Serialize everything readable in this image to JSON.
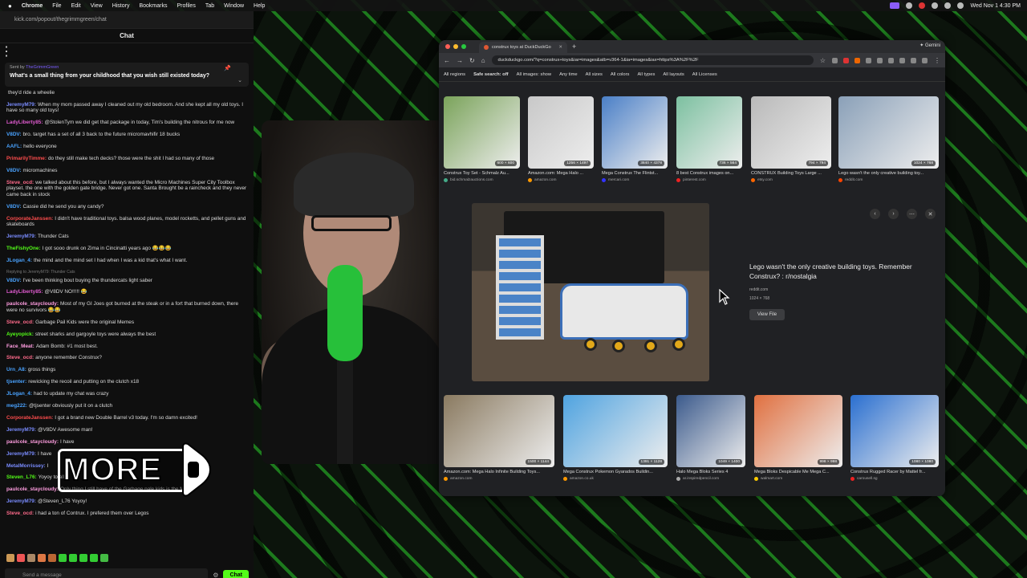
{
  "menubar": {
    "app": "Chrome",
    "items": [
      "File",
      "Edit",
      "View",
      "History",
      "Bookmarks",
      "Profiles",
      "Tab",
      "Window",
      "Help"
    ],
    "clock": "Wed Nov 1 4:30 PM"
  },
  "chat": {
    "url": "kick.com/popout/thegrimmgreen/chat",
    "title": "Chat",
    "pinned": {
      "sent_by_prefix": "Sent by",
      "sent_by_user": "TheGrimmGreen",
      "question": "What's a small thing from your childhood that you wish still existed today?"
    },
    "messages": [
      {
        "user": "",
        "color": "#ddd",
        "text": "they'd ride a wheelie"
      },
      {
        "user": "JeremyM79:",
        "color": "#7a8cff",
        "text": "When my mom passed away I cleaned out my old bedroom. And she kept all my old toys. I have so many old toys!"
      },
      {
        "user": "LadyLiberty85:",
        "color": "#e05bd0",
        "text": "@StolenTym we did get that package in today, Tim's building the nitrous for me now"
      },
      {
        "user": "V8DV:",
        "color": "#4aa3ff",
        "text": "bro. target has a set of all 3 back to the future micromavhifir 18 bucks"
      },
      {
        "user": "AAFL:",
        "color": "#4aa3ff",
        "text": "hello everyone"
      },
      {
        "user": "PrimarilyTimme:",
        "color": "#ff4d4d",
        "text": "do they still make tech decks? those were the shit I had so many of those"
      },
      {
        "user": "V8DV:",
        "color": "#4aa3ff",
        "text": "micromachines"
      },
      {
        "user": "Steve_ocd:",
        "color": "#ff6b8b",
        "text": "we talked about this before, but I always wanted the Micro Machines Super City Toolbox playset. the one with the golden gate bridge. Never got one. Santa Brought be a raincheck and they never came back in stock"
      },
      {
        "user": "V8DV:",
        "color": "#4aa3ff",
        "text": "Cassie did he send you any candy?"
      },
      {
        "user": "CorporateJanssen:",
        "color": "#ff4d4d",
        "text": "I didn't have traditional toys. balsa wood planes, model rocketts, and pellet guns and skateboards"
      },
      {
        "user": "JeremyM79:",
        "color": "#7a8cff",
        "text": "Thunder Cats"
      },
      {
        "user": "TheFishyOne:",
        "color": "#53fc18",
        "text": "I got sooo drunk on Zima in Cincinatti years ago 😂😂😂"
      },
      {
        "user": "JLogan_4:",
        "color": "#4aa3ff",
        "text": "the mind and the mind set I had when I was a kid that's what I want."
      },
      {
        "user": "V8DV:",
        "color": "#4aa3ff",
        "text": "I've been thinking bout buying the thundercats light saber",
        "reply": "Replying to JeremyM79: Thunder Cats"
      },
      {
        "user": "LadyLiberty85:",
        "color": "#e05bd0",
        "text": "@V8DV NO!!!!! 😂"
      },
      {
        "user": "paulcole_staycloudy:",
        "color": "#ff9de0",
        "text": "Most of my GI Joes got burned at the steak or in a fort that burned down, there were no survivors 😂😂"
      },
      {
        "user": "Steve_ocd:",
        "color": "#ff6b8b",
        "text": "Garbage Pail Kids were the original Memes"
      },
      {
        "user": "Ayeyopick:",
        "color": "#53fc18",
        "text": "street sharks and gargoyle toys were always the best"
      },
      {
        "user": "Face_Meat:",
        "color": "#ff9de0",
        "text": "Adam Bomb: #1 most best."
      },
      {
        "user": "Steve_ocd:",
        "color": "#ff6b8b",
        "text": "anyone remember Construx?"
      },
      {
        "user": "Urn_A8:",
        "color": "#4aa3ff",
        "text": "gross things"
      },
      {
        "user": "tjsenter:",
        "color": "#4aa3ff",
        "text": "rewicking the recoil and putting on the clutch x18"
      },
      {
        "user": "JLogan_4:",
        "color": "#4aa3ff",
        "text": "had to update my chat was crazy"
      },
      {
        "user": "meg222:",
        "color": "#4aa3ff",
        "text": "@tjsenter obviously put it on a clutch"
      },
      {
        "user": "CorporateJanssen:",
        "color": "#ff4d4d",
        "text": "I got a brand new Double Barrel v3 today. I'm so damn excited!"
      },
      {
        "user": "JeremyM79:",
        "color": "#7a8cff",
        "text": "@V8DV Awesome man!"
      },
      {
        "user": "paulcole_staycloudy:",
        "color": "#ff9de0",
        "text": "I have"
      },
      {
        "user": "JeremyM79:",
        "color": "#7a8cff",
        "text": "I have"
      },
      {
        "user": "MetalMorrissey:",
        "color": "#7a8cff",
        "text": "I"
      },
      {
        "user": "Steven_L76:",
        "color": "#53fc18",
        "text": "Yoyoy to all."
      },
      {
        "user": "paulcole_staycloudy:",
        "color": "#ff9de0",
        "text": "Only thing I still have of the Garbage pale kids is the Movie"
      },
      {
        "user": "JeremyM79:",
        "color": "#7a8cff",
        "text": "@Steven_L76 Yoyoy!"
      },
      {
        "user": "Steve_ocd:",
        "color": "#ff6b8b",
        "text": "i had a ton of Contrux. I prefered them over Legos"
      }
    ],
    "send_placeholder": "Send a message",
    "send_button": "Chat"
  },
  "overlay": {
    "more_text": "MORE"
  },
  "browser": {
    "tab_title": "construx toys at DuckDuckGo",
    "tab_gemini": "Gemini",
    "url": "duckduckgo.com/?q=construx+toys&iar=images&atb=v364-1&ia=images&iax=https%3A%2F%2F",
    "filters": [
      "All regions",
      "Safe search: off",
      "All images: show",
      "Any time",
      "All sizes",
      "All colors",
      "All types",
      "All layouts",
      "All Licenses"
    ],
    "row1": [
      {
        "caption": "Construx Toy Set - Schmalz Au...",
        "source": "bid.schmalzauctions.com",
        "dims": "600 × 600",
        "color": "#7aa35a",
        "srccolor": "#4a8"
      },
      {
        "caption": "Amazon.com: Mega Halo ...",
        "source": "amazon.com",
        "dims": "1256 × 1497",
        "color": "#c8c8c8",
        "srccolor": "#f90"
      },
      {
        "caption": "Mega Construx The Flintst...",
        "source": "mercari.com",
        "dims": "3840 × 4378",
        "color": "#4a7fc7",
        "srccolor": "#33f"
      },
      {
        "caption": "8 best Construx images on...",
        "source": "pinterest.com",
        "dims": "736 × 564",
        "color": "#7cc0a0",
        "srccolor": "#e22"
      },
      {
        "caption": "CONSTRUX Building Toys Large ...",
        "source": "etsy.com",
        "dims": "794 × 794",
        "color": "#b9b9b9",
        "srccolor": "#f60"
      },
      {
        "caption": "Lego wasn't the only creative building toy...",
        "source": "reddit.com",
        "dims": "1024 × 768",
        "color": "#8aa0b8",
        "srccolor": "#f40"
      }
    ],
    "preview": {
      "title": "Lego wasn't the only creative building toys. Remember Construx? : r/nostalgia",
      "source": "reddit.com",
      "dims": "1024 × 768",
      "button": "View File"
    },
    "row2": [
      {
        "caption": "Amazon.com: Mega Halo Infinite Building Toys...",
        "source": "amazon.com",
        "dims": "1500 × 1144",
        "color": "#8a7a60",
        "srccolor": "#f90"
      },
      {
        "caption": "Mega Construx Pokemon Gyarados Buildin...",
        "source": "amazon.co.uk",
        "dims": "1391 × 1128",
        "color": "#4fa3e0",
        "srccolor": "#f90"
      },
      {
        "caption": "Halo Mega Bloks Series 4",
        "source": "ar.inspiredpencil.com",
        "dims": "1049 × 1400",
        "color": "#3b5a8c",
        "srccolor": "#aaa"
      },
      {
        "caption": "Mega Bloks Despicable Me Mega C...",
        "source": "walmart.com",
        "dims": "998 × 998",
        "color": "#e07040",
        "srccolor": "#fc0"
      },
      {
        "caption": "Construx Rugged Racer by Mattel fr...",
        "source": "carousell.sg",
        "dims": "1080 × 1080",
        "color": "#2a6fd0",
        "srccolor": "#e22"
      }
    ]
  }
}
